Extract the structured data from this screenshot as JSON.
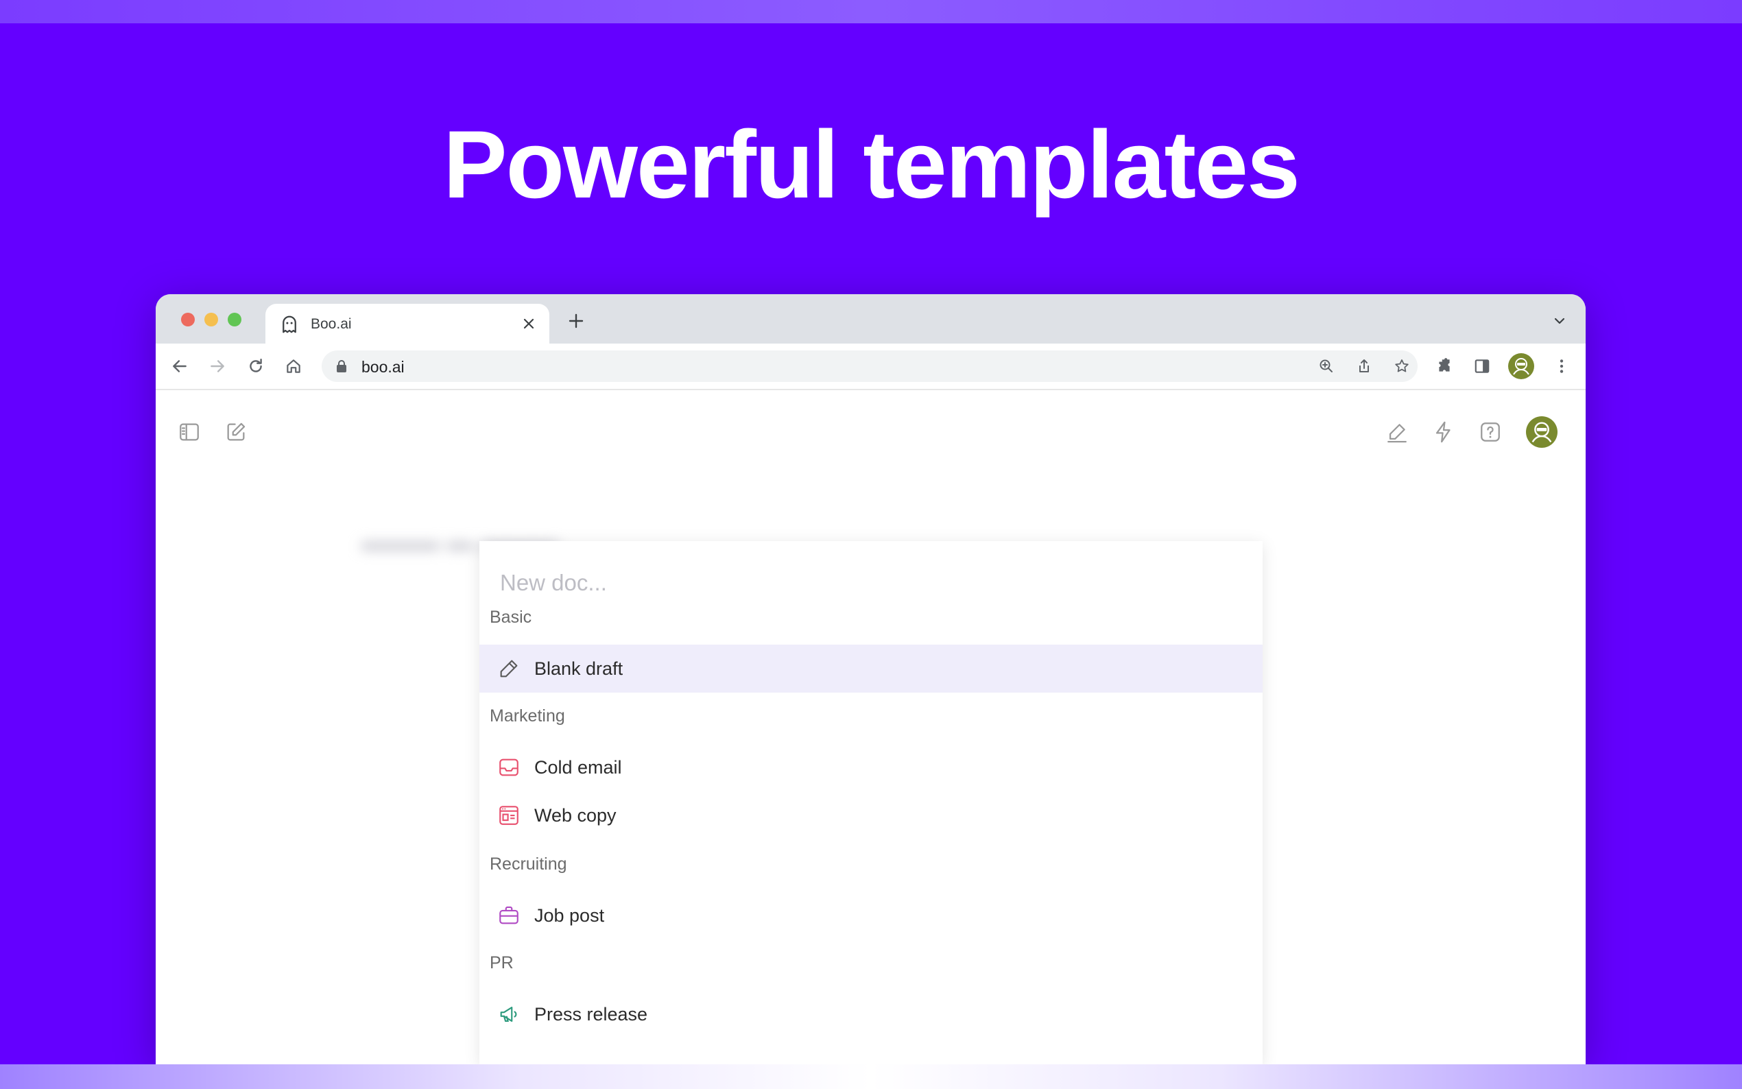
{
  "headline": "Powerful templates",
  "browser": {
    "tab_title": "Boo.ai",
    "url": "boo.ai"
  },
  "editor": {
    "search_placeholder": "New doc...",
    "sections": [
      {
        "label": "Basic",
        "items": [
          {
            "label": "Blank draft",
            "icon": "pencil-icon",
            "highlighted": true
          }
        ]
      },
      {
        "label": "Marketing",
        "items": [
          {
            "label": "Cold email",
            "icon": "inbox-icon"
          },
          {
            "label": "Web copy",
            "icon": "web-page-icon"
          }
        ]
      },
      {
        "label": "Recruiting",
        "items": [
          {
            "label": "Job post",
            "icon": "briefcase-icon"
          }
        ]
      },
      {
        "label": "PR",
        "items": [
          {
            "label": "Press release",
            "icon": "megaphone-icon"
          }
        ]
      }
    ]
  },
  "colors": {
    "background": "#6400FF",
    "highlight": "#efedfb",
    "avatar": "#7a8a2e",
    "marketing_icon": "#e8506e",
    "recruiting_icon": "#b04ac4",
    "pr_icon": "#2e9b7e"
  }
}
